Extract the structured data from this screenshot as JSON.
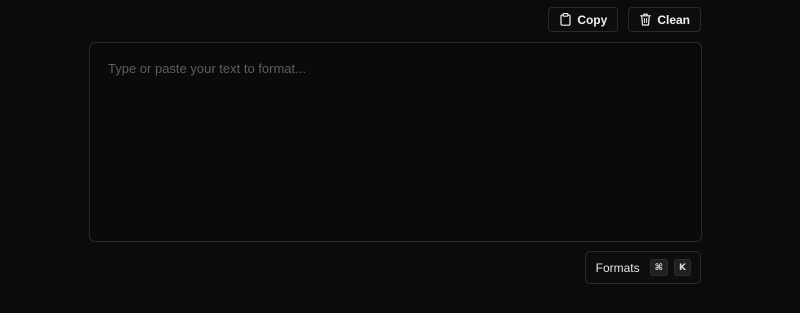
{
  "toolbar": {
    "copy_label": "Copy",
    "copy_icon": "clipboard-icon",
    "clean_label": "Clean",
    "clean_icon": "trash-icon"
  },
  "editor": {
    "placeholder": "Type or paste your text to format...",
    "value": ""
  },
  "formats": {
    "label": "Formats",
    "shortcut_keys": [
      "⌘",
      "K"
    ]
  },
  "colors": {
    "background": "#0b0b0b",
    "border": "#2a2a2a",
    "text": "#f2f2f2",
    "placeholder": "#5e5e5e"
  }
}
